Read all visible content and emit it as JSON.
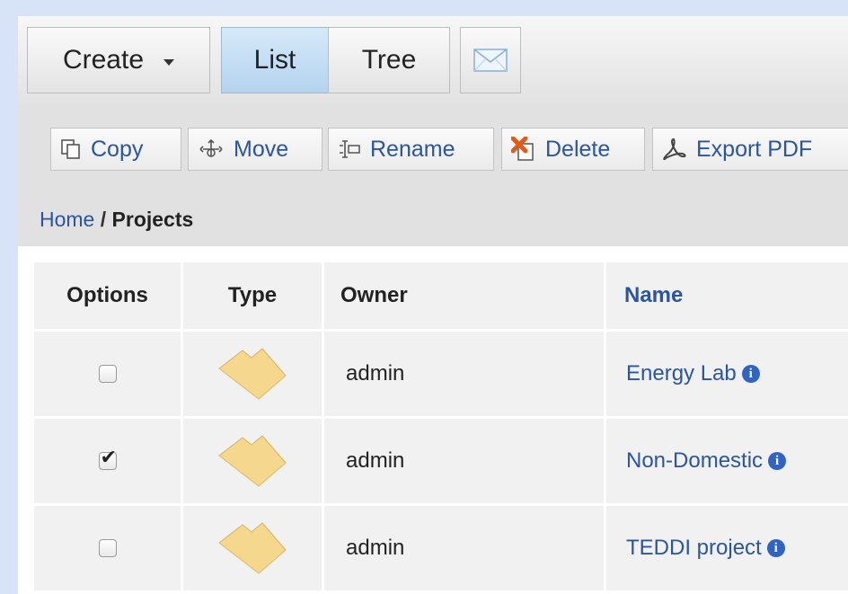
{
  "viewbar": {
    "create_label": "Create",
    "list_label": "List",
    "tree_label": "Tree",
    "mail_icon": "envelope-icon"
  },
  "actions": {
    "copy": "Copy",
    "move": "Move",
    "rename": "Rename",
    "delete": "Delete",
    "export_pdf": "Export PDF"
  },
  "breadcrumb": {
    "home": "Home",
    "separator": "/",
    "current": "Projects"
  },
  "table": {
    "headers": {
      "options": "Options",
      "type": "Type",
      "owner": "Owner",
      "name": "Name"
    },
    "rows": [
      {
        "checked": false,
        "type_icon": "folder-icon",
        "owner": "admin",
        "name": "Energy Lab"
      },
      {
        "checked": true,
        "type_icon": "folder-icon",
        "owner": "admin",
        "name": "Non-Domestic"
      },
      {
        "checked": false,
        "type_icon": "folder-icon",
        "owner": "admin",
        "name": "TEDDI project"
      }
    ]
  },
  "colors": {
    "link": "#2a55a3",
    "active_tab": "#b4d3ef",
    "page_bg": "#d7e3f7"
  }
}
